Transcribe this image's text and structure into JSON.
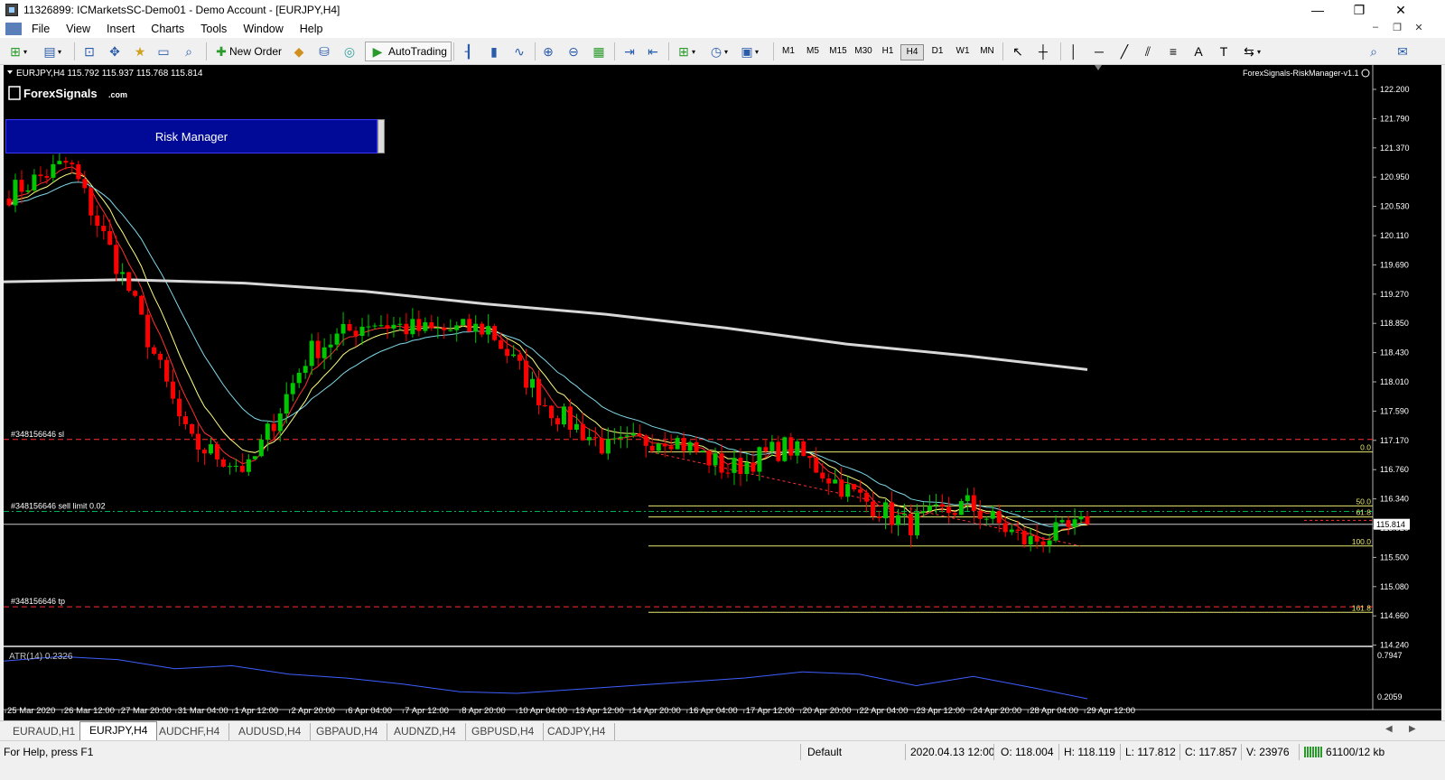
{
  "window": {
    "title": "11326899: ICMarketsSC-Demo01 - Demo Account - [EURJPY,H4]",
    "minimize": "—",
    "maximize": "❐",
    "close": "✕"
  },
  "menu": {
    "items": [
      "File",
      "View",
      "Insert",
      "Charts",
      "Tools",
      "Window",
      "Help"
    ],
    "mdi_min": "–",
    "mdi_restore": "❐",
    "mdi_close": "✕"
  },
  "toolbar": {
    "new_order_label": "New Order",
    "autotrading_label": "AutoTrading",
    "timeframes": [
      "M1",
      "M5",
      "M15",
      "M30",
      "H1",
      "H4",
      "D1",
      "W1",
      "MN"
    ],
    "active_timeframe": "H4"
  },
  "chart": {
    "header": "EURJPY,H4  115.792 115.937 115.768 115.814",
    "logo_text": "ForexSignals",
    "logo_suffix": ".com",
    "indicator_name": "ForexSignals-RiskManager-v1.1",
    "risk_manager_label": "Risk Manager",
    "current_price": "115.814",
    "order_labels": {
      "sl": "#348156646 sl",
      "sell_limit": "#348156646 sell limit 0.02",
      "tp": "#348156646 tp"
    },
    "fib_labels": [
      "0.0",
      "50.0",
      "61.8",
      "100.0",
      "161.8"
    ],
    "atr_label": "ATR(14) 0.2326",
    "atr_scale": [
      "0.7947",
      "0.2059"
    ],
    "colors": {
      "bull": "#00c800",
      "bear": "#ff0000",
      "ma_slow": "#d8d8d8",
      "ma_fast_red": "#ff3030",
      "ma_fast_yellow": "#ffff80",
      "ma_cyan": "#7fd8e8",
      "fib": "#e8e870",
      "sl_line": "#ff3030",
      "pending_line": "#00b050",
      "atr": "#3f5fff"
    }
  },
  "chart_data": {
    "type": "candlestick",
    "symbol": "EURJPY",
    "timeframe": "H4",
    "y_ticks": [
      "122.200",
      "121.790",
      "121.370",
      "120.950",
      "120.530",
      "120.110",
      "119.690",
      "119.270",
      "118.850",
      "118.430",
      "118.010",
      "117.590",
      "117.170",
      "116.760",
      "116.340",
      "115.920",
      "115.500",
      "115.080",
      "114.660",
      "114.240"
    ],
    "x_ticks": [
      "25 Mar 2020",
      "26 Mar 12:00",
      "27 Mar 20:00",
      "31 Mar 04:00",
      "1 Apr 12:00",
      "2 Apr 20:00",
      "6 Apr 04:00",
      "7 Apr 12:00",
      "8 Apr 20:00",
      "10 Apr 04:00",
      "13 Apr 12:00",
      "14 Apr 20:00",
      "16 Apr 04:00",
      "17 Apr 12:00",
      "20 Apr 20:00",
      "22 Apr 04:00",
      "23 Apr 12:00",
      "24 Apr 20:00",
      "28 Apr 04:00",
      "29 Apr 12:00"
    ],
    "ylim": [
      114.1,
      122.35
    ],
    "key_prices": [
      120.6,
      121.05,
      119.2,
      117.0,
      116.6,
      118.3,
      118.75,
      118.6,
      118.65,
      117.5,
      116.9,
      117.1,
      116.6,
      116.95,
      116.3,
      115.8,
      116.1,
      115.55,
      115.81
    ],
    "levels": {
      "sl": 117.04,
      "sell_limit": 116.0,
      "tp": 114.62,
      "fib_0": 116.86,
      "fib_50": 116.08,
      "fib_61_8": 115.92,
      "fib_100": 115.5,
      "fib_161_8": 114.54,
      "bid": 115.814
    },
    "ma_slow_values": [
      119.32,
      119.35,
      119.3,
      119.18,
      119.0,
      118.85,
      118.65,
      118.42,
      118.25,
      118.05
    ],
    "atr_values": [
      0.72,
      0.78,
      0.74,
      0.62,
      0.66,
      0.55,
      0.5,
      0.42,
      0.32,
      0.3,
      0.35,
      0.4,
      0.45,
      0.5,
      0.58,
      0.55,
      0.4,
      0.52,
      0.38,
      0.23
    ]
  },
  "tabs": [
    "EURAUD,H1",
    "EURJPY,H4",
    "AUDCHF,H4",
    "AUDUSD,H4",
    "GBPAUD,H4",
    "AUDNZD,H4",
    "GBPUSD,H4",
    "CADJPY,H4"
  ],
  "active_tab": "EURJPY,H4",
  "status": {
    "help": "For Help, press F1",
    "profile": "Default",
    "datetime": "2020.04.13 12:00",
    "open": "O: 118.004",
    "high": "H: 118.119",
    "low": "L: 117.812",
    "close": "C: 117.857",
    "volume": "V: 23976",
    "traffic": "61100/12 kb"
  }
}
